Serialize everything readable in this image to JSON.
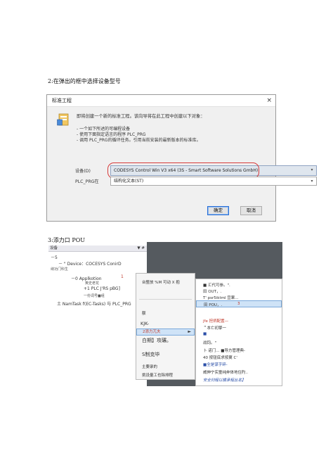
{
  "section2": {
    "heading": "2:在弹出的框中选择设备型号",
    "dialog": {
      "title": "标准工程",
      "close_label": "×",
      "intro": "即将创建一个新的标准工程。该向导将在此工程中创建以下对象：",
      "bullets": [
        "- 一个如下所述的可编程设备",
        "- 使用下面指定语言的程序 PLC_PRG",
        "- 调用 PLC_PRG的循环任务。引用当前安装的最新版本的标准库。"
      ],
      "device_label": "设备(D)",
      "device_value": "CODESYS Control Win V3 x64 (3S - Smart Software Solutions GmbH)",
      "plc_prg_label": "PLC_PRG在",
      "plc_prg_value": "结构化文本(ST)",
      "ok_label": "确定",
      "cancel_label": "取消"
    }
  },
  "section3": {
    "heading": "3:添力口 POU",
    "panel": {
      "header": "设备",
      "pin": "▼ #",
      "lines": [
        "－5",
        "－ \" Device：COCESYS ConirD",
        "纳功门科生",
        "－0 Applkotion",
        "1",
        "奥史老花",
        "+1 PLC J'RS pBG]",
        "一份词号■组",
        "土 NamTask f(EC-Tasks) 与 PLC_PRG"
      ]
    },
    "menu_main": {
      "items": [
        "台整放 %M   可动 X   抱",
        "额",
        "KJK-",
        "2添力兀夫",
        "白期】攻碾。",
        "S制克毕",
        "主要录的",
        "挑设量工也除排程"
      ],
      "submenu_arrow": "►"
    },
    "menu_sub": {
      "items": [
        "■ 汇代可参。\".",
        "田 OUT，.",
        "T' psr5iktml 宜果...",
        "田 POU，.",
        "3",
        "jfe 担炳配置—",
        "＂本亡初擎一",
        "■",
        "战钧。\"",
        "卜 诺门...  ■导方管理典-",
        "40 按钮底求按翼 C'",
        "■全是谋字碎-",
        "威伸宁实童纯奔体地住旳..",
        "安全归程以模承程丛名】"
      ]
    }
  }
}
